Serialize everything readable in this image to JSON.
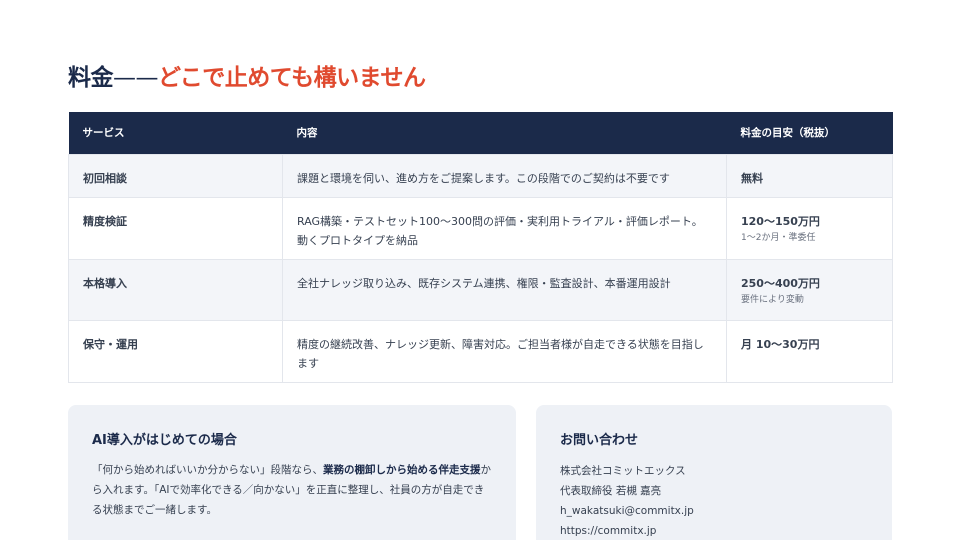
{
  "title": {
    "main": "料金",
    "dash": "——",
    "accent": "どこで止めても構いません"
  },
  "table": {
    "headers": [
      "サービス",
      "内容",
      "料金の目安（税抜）"
    ],
    "rows": [
      {
        "service": "初回相談",
        "content": "課題と環境を伺い、進め方をご提案します。この段階でのご契約は不要です",
        "price": "無料",
        "note": ""
      },
      {
        "service": "精度検証",
        "content": "RAG構築・テストセット100〜300問の評価・実利用トライアル・評価レポート。動くプロトタイプを納品",
        "price": "120〜150万円",
        "note": "1〜2か月・準委任"
      },
      {
        "service": "本格導入",
        "content": "全社ナレッジ取り込み、既存システム連携、権限・監査設計、本番運用設計",
        "price": "250〜400万円",
        "note": "要件により変動"
      },
      {
        "service": "保守・運用",
        "content": "精度の継続改善、ナレッジ更新、障害対応。ご担当者様が自走できる状態を目指します",
        "price": "月 10〜30万円",
        "note": ""
      }
    ]
  },
  "first_time": {
    "title": "AI導入がはじめての場合",
    "text_1": "「何から始めればいいか分からない」段階なら、",
    "text_bold": "業務の棚卸しから始める伴走支援",
    "text_2": "から入れます。「AIで効率化できる／向かない」を正直に整理し、社員の方が自走できる状態までご一緒します。"
  },
  "contact": {
    "title": "お問い合わせ",
    "company": "株式会社コミットエックス",
    "representative": "代表取締役 若槻 嘉亮",
    "email": "h_wakatsuki@commitx.jp",
    "url": "https://commitx.jp"
  },
  "colors": {
    "navy": "#1b2a4a",
    "accent": "#e04a2f",
    "card_bg": "#eef1f6"
  }
}
